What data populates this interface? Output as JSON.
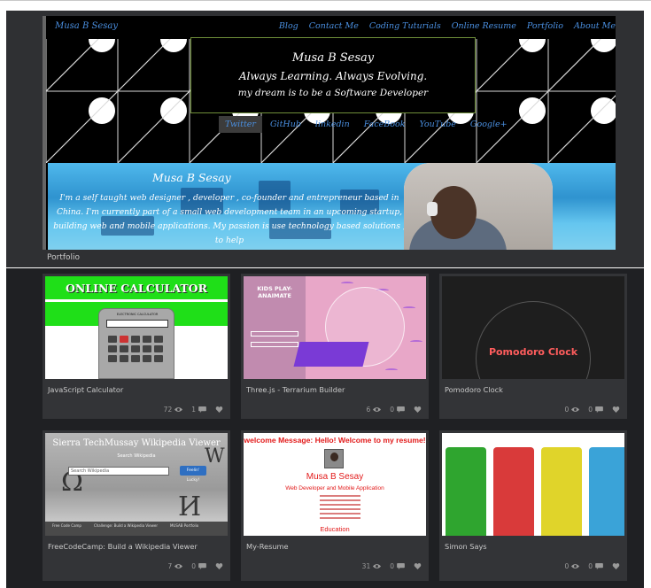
{
  "site": {
    "brand": "Musa B Sesay",
    "nav": [
      "Blog",
      "Contact Me",
      "Coding Tuturials",
      "Online Resume",
      "Portfolio",
      "About Me"
    ],
    "hero": {
      "name": "Musa B Sesay",
      "tagline": "Always Learning. Always Evolving.",
      "dream": "my dream is to be a Software Developer"
    },
    "social": [
      "Twitter",
      "GitHub",
      "linkedin",
      "FaceBook",
      "YouTube",
      "Google+"
    ],
    "about": {
      "name": "Musa B Sesay",
      "text": "I'm a self taught web designer , developer , co-founder and entrepreneur based in China. I'm currently part of a small web development team in an upcoming startup, building web and mobile applications. My passion is use technology based solutions , to help"
    },
    "caption": "Portfolio"
  },
  "projects": [
    {
      "title": "JavaScript Calculator",
      "views": "72",
      "comments": "1",
      "thumb": {
        "heading": "ONLINE CALCULATOR",
        "device_label": "ELECTRONIC CALCULATOR"
      }
    },
    {
      "title": "Three.js - Terrarium Builder",
      "views": "6",
      "comments": "0",
      "thumb": {
        "heading": "KIDS PLAY-ANAIMATE"
      }
    },
    {
      "title": "Pomodoro Clock",
      "views": "0",
      "comments": "0",
      "thumb": {
        "heading": "Pomodoro Clock"
      }
    },
    {
      "title": "FreeCodeCamp: Build a Wikipedia Viewer",
      "views": "7",
      "comments": "0",
      "thumb": {
        "heading": "Sierra TechMussay Wikipedia Viewer",
        "sub": "Search Wikipedia",
        "placeholder": "Search Wikipedia",
        "button": "Feelin' Lucky!",
        "footer": [
          "Free Code Camp",
          "Challenge: Build a Wikipedia Viewer",
          "MUSAB Portfolio"
        ]
      }
    },
    {
      "title": "My-Resume",
      "views": "31",
      "comments": "0",
      "thumb": {
        "heading": "welcome Message: Hello! Welcome to my resume!",
        "name": "Musa B Sesay",
        "role": "Web Developer and Mobile Application",
        "section": "Education"
      }
    },
    {
      "title": "Simon Says",
      "views": "0",
      "comments": "0",
      "thumb": {
        "colors": [
          "#2fa52f",
          "#d93a3a",
          "#e0d42a",
          "#3aa3d8"
        ]
      }
    }
  ],
  "colors": {
    "link": "#4a8fe0",
    "calculator_green": "#1fdf18",
    "pomodoro_red": "#ff5d5d",
    "resume_red": "#e21a1a"
  },
  "icons": {
    "views": "eye-icon",
    "comments": "comment-icon",
    "likes": "heart-icon"
  }
}
